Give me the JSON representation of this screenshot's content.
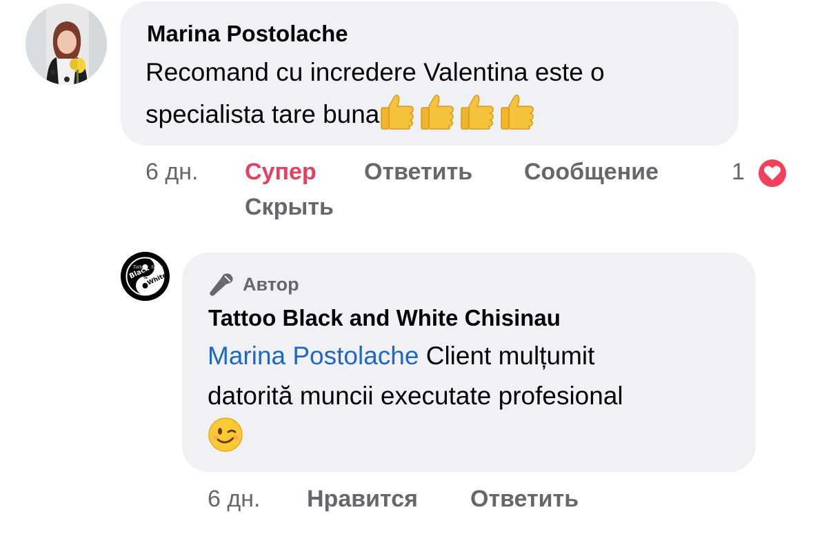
{
  "comment": {
    "author": "Marina Postolache",
    "text_line1": "Recomand cu incredere Valentina este o",
    "text_line2": "specialista tare buna",
    "emoji": "thumbs-up-icon",
    "time": "6 дн.",
    "actions": {
      "super": "Супер",
      "reply": "Ответить",
      "message": "Сообщение",
      "hide": "Скрыть"
    },
    "reaction_count": "1",
    "reaction_icon": "love-reaction-icon"
  },
  "reply": {
    "badge": "Автор",
    "author": "Tattoo Black and White Chisinau",
    "mention": "Marina Postolache",
    "text_part1": " Client mulțumit",
    "text_line2": "datorită muncii executate profesional",
    "emoji": "winking-face-icon",
    "time": "6 дн.",
    "actions": {
      "like": "Нравится",
      "reply": "Ответить"
    },
    "logo_text": [
      "Tattoo",
      "Black",
      "&",
      "White",
      "Salon"
    ]
  },
  "colors": {
    "bubble_bg": "#f0f1f4",
    "meta_text": "#65676b",
    "super_red": "#e4405f",
    "mention_blue": "#1e67c6"
  }
}
